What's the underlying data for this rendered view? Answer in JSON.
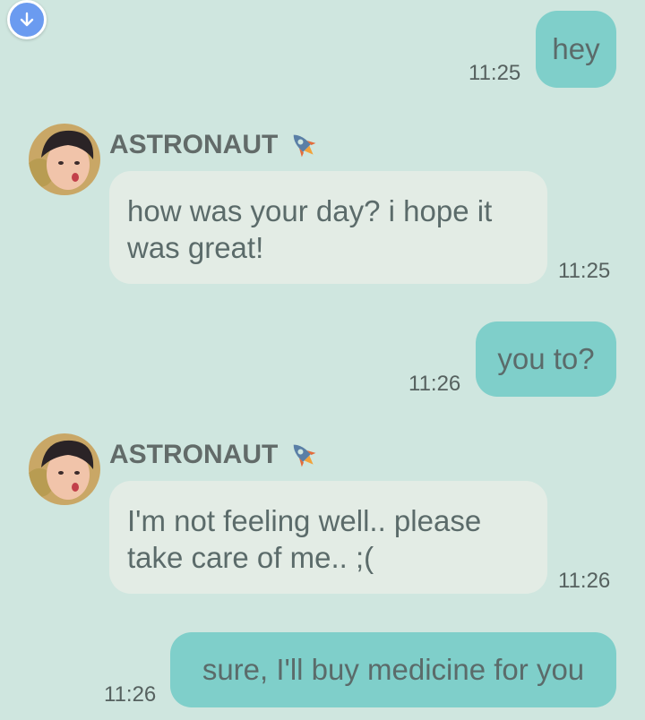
{
  "messages": [
    {
      "direction": "out",
      "text": "hey",
      "time": "11:25"
    },
    {
      "direction": "in",
      "sender": "ASTRONAUT",
      "sender_icon": "rocket-icon",
      "text": "how was your day? i hope it was great!",
      "time": "11:25"
    },
    {
      "direction": "out",
      "text": "you to?",
      "time": "11:26"
    },
    {
      "direction": "in",
      "sender": "ASTRONAUT",
      "sender_icon": "rocket-icon",
      "text": "I'm not feeling well.. please take care of me.. ;(",
      "time": "11:26"
    },
    {
      "direction": "out",
      "text": "sure, I'll buy medicine for you",
      "time": "11:26"
    }
  ],
  "scroll_button_icon": "arrow-down-icon",
  "colors": {
    "background": "#cfe6df",
    "outgoing_bubble": "#7fcfca",
    "incoming_bubble": "#e3ece5",
    "text": "#5b6b6a",
    "scroll_button": "#6b9bf0"
  }
}
